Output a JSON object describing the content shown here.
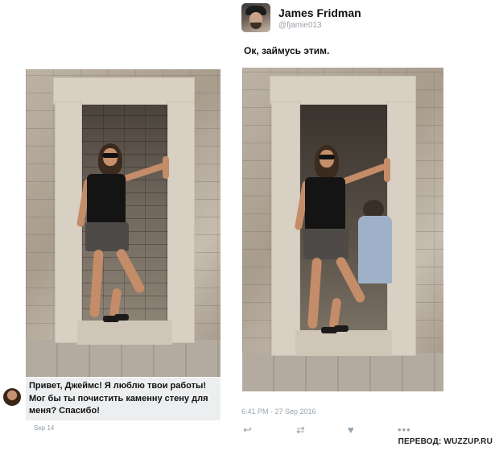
{
  "tweet": {
    "author_name": "James Fridman",
    "author_handle": "@fjamie013",
    "text": "Ок, займусь этим.",
    "timestamp": "6:41 PM - 27 Sep 2016",
    "actions": [
      "reply-icon",
      "retweet-icon",
      "like-icon",
      "more-icon"
    ]
  },
  "comment": {
    "text": "Привет, Джеймс! Я люблю твои работы! Мог бы ты почистить каменну стену для меня? Спасибо!",
    "date": "Sep 14"
  },
  "credit": "ПЕРЕВОД: WUZZUP.RU",
  "icons": {
    "reply": "↩",
    "retweet": "⇄",
    "like": "♥",
    "more": "•••"
  },
  "colors": {
    "muted": "#9aa3ab",
    "bubble": "#eceef0"
  }
}
